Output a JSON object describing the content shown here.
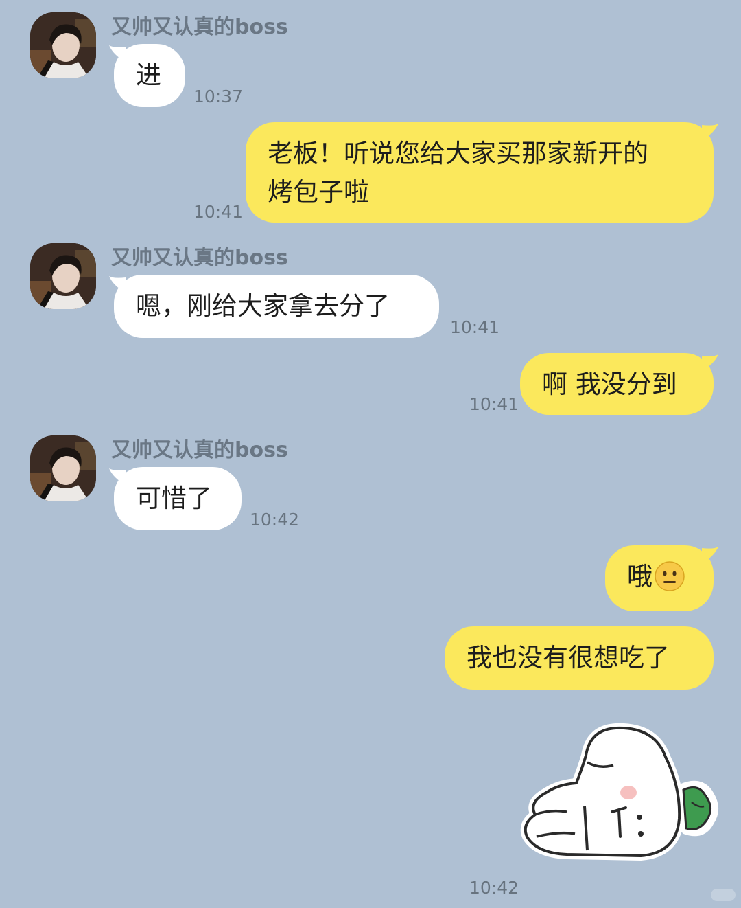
{
  "contact": {
    "name": "又帅又认真的boss"
  },
  "messages": [
    {
      "sender": "boss",
      "name": "又帅又认真的boss",
      "text": "进",
      "time": "10:37"
    },
    {
      "sender": "me",
      "text": "老板！听说您给大家买那家新开的烤包子啦",
      "line1": "老板！听说您给大家买那家新开的",
      "line2": "烤包子啦",
      "time": "10:41"
    },
    {
      "sender": "boss",
      "name": "又帅又认真的boss",
      "text": "嗯，刚给大家拿去分了",
      "time": "10:41"
    },
    {
      "sender": "me",
      "text": "啊 我没分到",
      "time": "10:41"
    },
    {
      "sender": "boss",
      "name": "又帅又认真的boss",
      "text": "可惜了",
      "time": "10:42"
    },
    {
      "sender": "me",
      "text": "哦",
      "emoji": "neutral-face-icon"
    },
    {
      "sender": "me",
      "text": "我也没有很想吃了"
    },
    {
      "sender": "me",
      "sticker": "bunny-lying-sticker",
      "time": "10:42"
    }
  ],
  "colors": {
    "background": "#afc0d3",
    "incoming_bubble": "#ffffff",
    "outgoing_bubble": "#fbe85c",
    "name_text": "#6a7785",
    "time_text": "#67737f"
  }
}
